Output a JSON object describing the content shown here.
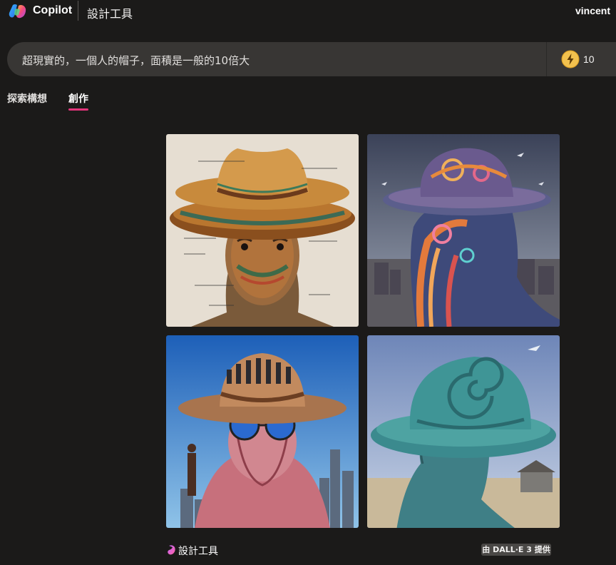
{
  "header": {
    "brand": "Copilot",
    "product": "設計工具",
    "user": "vincent"
  },
  "prompt": {
    "text": "超現實的，一個人的帽子，面積是一般的10倍大",
    "boosts": "10"
  },
  "tabs": [
    {
      "label": "探索構想",
      "active": false
    },
    {
      "label": "創作",
      "active": true
    }
  ],
  "tab_accent_color": "#e3347b",
  "tiles": [
    {
      "subject": "man-with-giant-cowboy-hat-diagram"
    },
    {
      "subject": "swirling-profile-with-hat-over-town"
    },
    {
      "subject": "man-with-crowd-on-hat-and-sunglasses"
    },
    {
      "subject": "teal-profile-with-spiral-hat"
    }
  ],
  "footer": {
    "label": "設計工具",
    "badge": "由 DALL·E 3 提供"
  }
}
